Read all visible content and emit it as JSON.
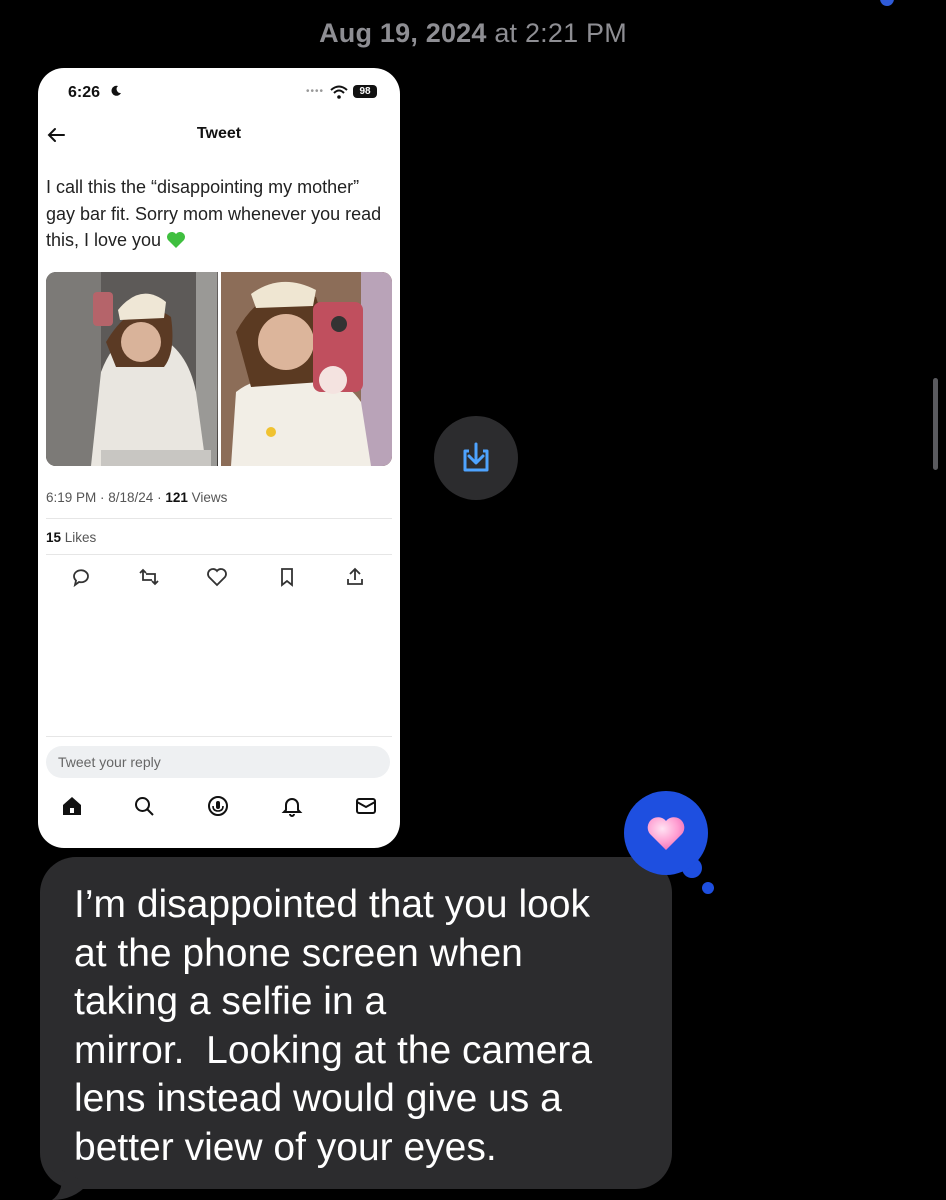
{
  "conversation": {
    "timestamp_date": "Aug 19, 2024",
    "timestamp_at": "at",
    "timestamp_time": "2:21 PM"
  },
  "attachment": {
    "status_time": "6:26",
    "battery": "98",
    "screen_title": "Tweet",
    "tweet_text": "I call this the “disappointing my mother” gay bar fit. Sorry mom whenever you read this, I love you",
    "tweet_time": "6:19 PM · 8/18/24 · ",
    "views_count": "121",
    "views_label": " Views",
    "likes_count": "15",
    "likes_label": " Likes",
    "reply_placeholder": "Tweet your reply",
    "icons": {
      "emoji": "green-heart-icon",
      "actions": [
        "reply-icon",
        "retweet-icon",
        "like-icon",
        "bookmark-icon",
        "share-icon"
      ],
      "tabs": [
        "home-icon",
        "search-icon",
        "spaces-icon",
        "notifications-icon",
        "messages-icon"
      ]
    }
  },
  "save_button": {
    "icon": "download-icon"
  },
  "message": {
    "text": "I’m disappointed that you look\nat the phone screen when\ntaking a selfie in a\nmirror.  Looking at the camera\nlens instead would give us a\nbetter view of your eyes.",
    "tapback": "heart-tapback-icon"
  },
  "colors": {
    "background": "#000000",
    "bubble": "#2c2c2e",
    "tapback": "#1e4fe0",
    "timestamp": "#8e8e93"
  }
}
